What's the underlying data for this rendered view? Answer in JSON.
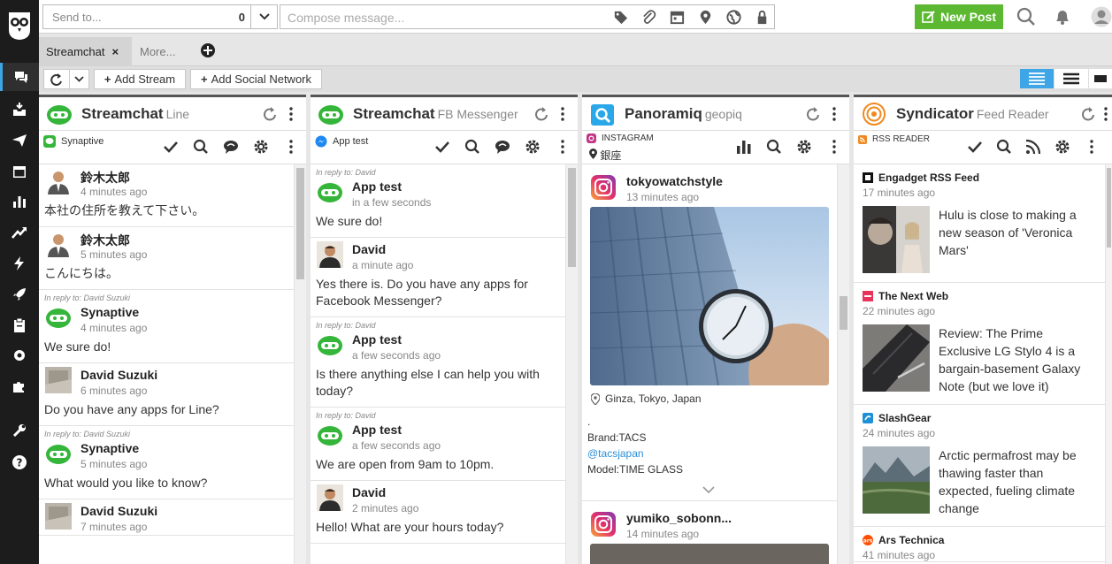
{
  "topbar": {
    "send_to_placeholder": "Send to...",
    "send_to_count": "0",
    "compose_placeholder": "Compose message...",
    "new_post_label": "New Post"
  },
  "tabs": [
    {
      "label": "Streamchat",
      "close": "×"
    },
    {
      "label": "More..."
    }
  ],
  "toolbar": {
    "add_stream": "Add Stream",
    "add_network": "Add Social Network"
  },
  "columns": [
    {
      "title": "Streamchat",
      "subtitle": "Line",
      "account": "Synaptive",
      "messages": [
        {
          "name": "鈴木太郎",
          "time": "4 minutes ago",
          "body": "本社の住所を教えて下さい。"
        },
        {
          "name": "鈴木太郎",
          "time": "5 minutes ago",
          "body": "こんにちは。"
        },
        {
          "reply": "In reply to: David Suzuki",
          "name": "Synaptive",
          "time": "4 minutes ago",
          "body": "We sure do!"
        },
        {
          "name": "David Suzuki",
          "time": "6 minutes ago",
          "body": "Do you have any apps for Line?"
        },
        {
          "reply": "In reply to: David Suzuki",
          "name": "Synaptive",
          "time": "5 minutes ago",
          "body": "What would you like to know?"
        },
        {
          "name": "David Suzuki",
          "time": "7 minutes ago",
          "body": ""
        }
      ]
    },
    {
      "title": "Streamchat",
      "subtitle": "FB Messenger",
      "account": "App test",
      "messages": [
        {
          "reply": "In reply to: David",
          "name": "App test",
          "time": "in a few seconds",
          "body": "We sure do!"
        },
        {
          "name": "David",
          "time": "a minute ago",
          "body": "Yes there is. Do you have any apps for Facebook Messenger?"
        },
        {
          "reply": "In reply to: David",
          "name": "App test",
          "time": "a few seconds ago",
          "body": "Is there anything else I can help you with today?"
        },
        {
          "reply": "In reply to: David",
          "name": "App test",
          "time": "a few seconds ago",
          "body": "We are open from 9am to 10pm."
        },
        {
          "name": "David",
          "time": "2 minutes ago",
          "body": "Hello! What are your hours today?"
        }
      ]
    },
    {
      "title": "Panoramiq",
      "subtitle": "geopiq",
      "account": "INSTAGRAM",
      "location": "銀座",
      "posts": [
        {
          "name": "tokyowatchstyle",
          "time": "13 minutes ago",
          "location": "Ginza, Tokyo, Japan",
          "dot": ".",
          "line1": "Brand:TACS",
          "link": "@tacsjapan",
          "line3": "Model:TIME GLASS"
        },
        {
          "name": "yumiko_sobonn...",
          "time": "14 minutes ago"
        }
      ]
    },
    {
      "title": "Syndicator",
      "subtitle": "Feed Reader",
      "account": "RSS READER",
      "items": [
        {
          "source": "Engadget RSS Feed",
          "time": "17 minutes ago",
          "headline": "Hulu is close to making a new season of 'Veronica Mars'"
        },
        {
          "source": "The Next Web",
          "time": "22 minutes ago",
          "headline": "Review: The Prime Exclusive LG Stylo 4 is a bargain-basement Galaxy Note (but we love it)"
        },
        {
          "source": "SlashGear",
          "time": "24 minutes ago",
          "headline": "Arctic permafrost may be thawing faster than expected, fueling climate change"
        },
        {
          "source": "Ars Technica",
          "time": "41 minutes ago",
          "headline": ""
        }
      ]
    }
  ],
  "colors": {
    "accent": "#3ea6e6",
    "new_post": "#5bb830",
    "sidebar": "#1c1c1c",
    "bot_green": "#35b53a",
    "link": "#2a8fd6"
  }
}
